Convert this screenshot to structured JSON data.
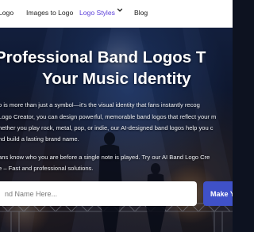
{
  "nav": {
    "items": [
      {
        "label": "Logo"
      },
      {
        "label": "Images to Logo"
      },
      {
        "label": "Logo Styles"
      },
      {
        "label": "Blog"
      }
    ],
    "active_color": "#5b3fd9",
    "dropdown_icon": "chevron-down-icon"
  },
  "hero": {
    "title_line1": "Professional Band Logos T",
    "title_line2": "Your Music Identity",
    "paragraph1_lines": [
      "o is more than just a symbol—it's the visual identity that fans instantly recog",
      "Logo Creator, you can design powerful, memorable band logos that reflect your m",
      "hether you play rock, metal, pop, or indie, our AI-designed band logos help you c",
      "nd build a lasting brand name."
    ],
    "paragraph2_lines": [
      "ans know who you are before a single note is played. Try our AI Band Logo Cre",
      "e – Fast and professional solutions."
    ],
    "search_placeholder": "nd Name Here...",
    "button_label": "Make Y",
    "accent_color": "#3f51c8"
  }
}
